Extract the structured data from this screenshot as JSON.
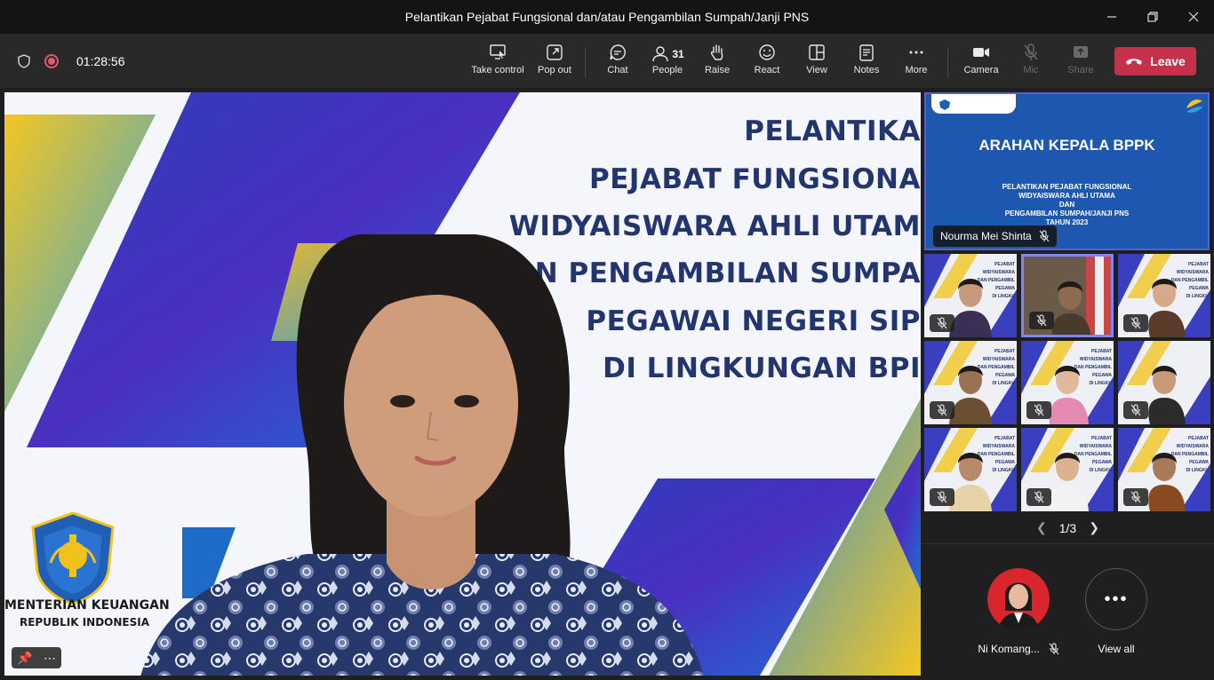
{
  "window": {
    "title": "Pelantikan Pejabat Fungsional dan/atau Pengambilan Sumpah/Janji PNS",
    "minimize_icon": "minimize-icon",
    "maximize_icon": "maximize-icon",
    "close_icon": "close-icon"
  },
  "meeting": {
    "timer": "01:28:56"
  },
  "toolbar": {
    "take_control": "Take control",
    "pop_out": "Pop out",
    "chat": "Chat",
    "people": "People",
    "people_count": "31",
    "raise": "Raise",
    "react": "React",
    "view": "View",
    "notes": "Notes",
    "more": "More",
    "camera": "Camera",
    "mic": "Mic",
    "share": "Share",
    "leave": "Leave"
  },
  "colors": {
    "leave_red": "#c4314b",
    "accent_purple": "#5b5fc7",
    "slide_navy": "#22356f"
  },
  "main_slide": {
    "lines": [
      "PELANTIKA",
      "PEJABAT FUNGSIONA",
      "WIDYAISWARA AHLI UTAM",
      "DAN PENGAMBILAN SUMPA",
      "PEGAWAI NEGERI SIP",
      "DI LINGKUNGAN BPI"
    ],
    "org_name": "MENTERIAN KEUANGAN",
    "org_sub": "REPUBLIK INDONESIA"
  },
  "shared_content": {
    "heading": "ARAHAN KEPALA BPPK",
    "sub_lines": [
      "PELANTIKAN PEJABAT FUNGSIONAL",
      "WIDYAISWARA AHLI UTAMA",
      "DAN",
      "PENGAMBILAN SUMPAH/JANJI PNS",
      "TAHUN 2023"
    ],
    "presenter": "Nourma Mei Shinta"
  },
  "tile_slide_lines": [
    "PEJABAT",
    "WIDYAISWARA",
    "DAN PENGAMBIL",
    "PEGAWA",
    "DI LINGKU"
  ],
  "pager": {
    "text": "1/3"
  },
  "bottom_participants": {
    "name": "Ni Komang...",
    "view_all": "View all"
  }
}
